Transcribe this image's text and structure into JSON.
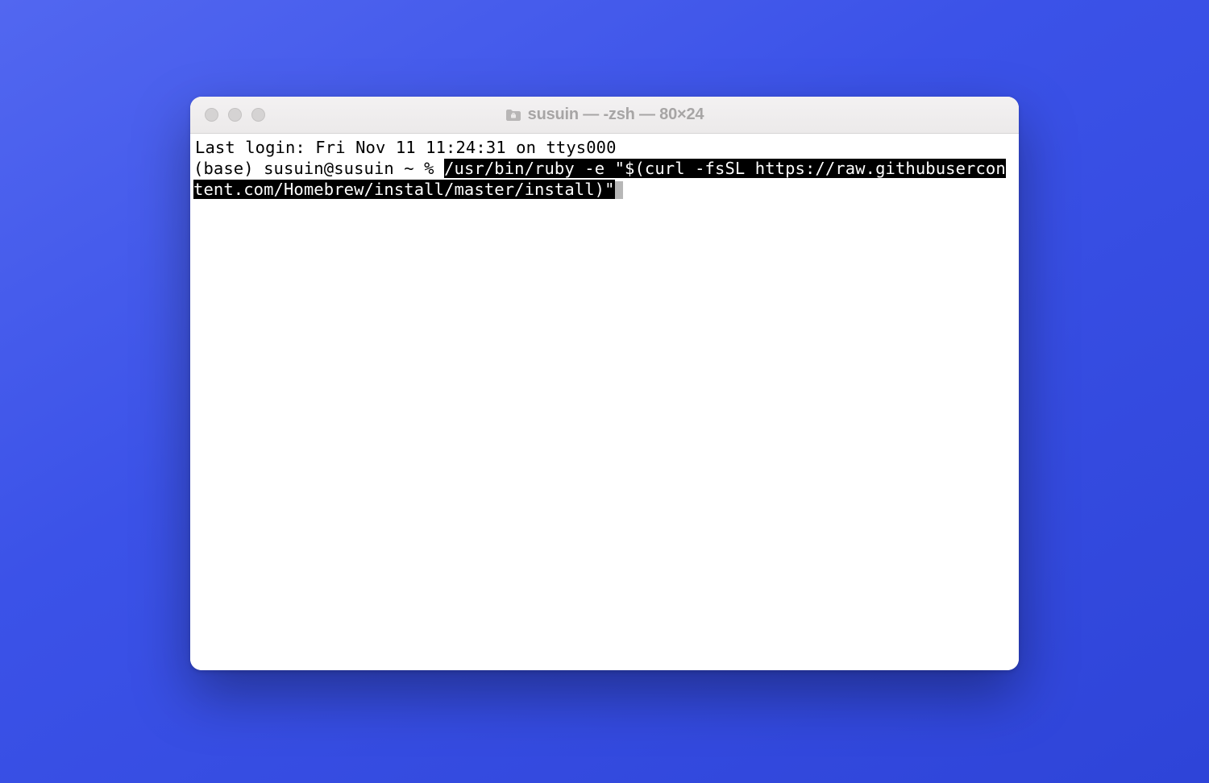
{
  "window": {
    "title": "susuin — -zsh — 80×24"
  },
  "terminal": {
    "last_login": "Last login: Fri Nov 11 11:24:31 on ttys000",
    "prompt": "(base) susuin@susuin ~ % ",
    "command": "/usr/bin/ruby -e \"$(curl -fsSL https://raw.githubusercontent.com/Homebrew/install/master/install)\""
  }
}
